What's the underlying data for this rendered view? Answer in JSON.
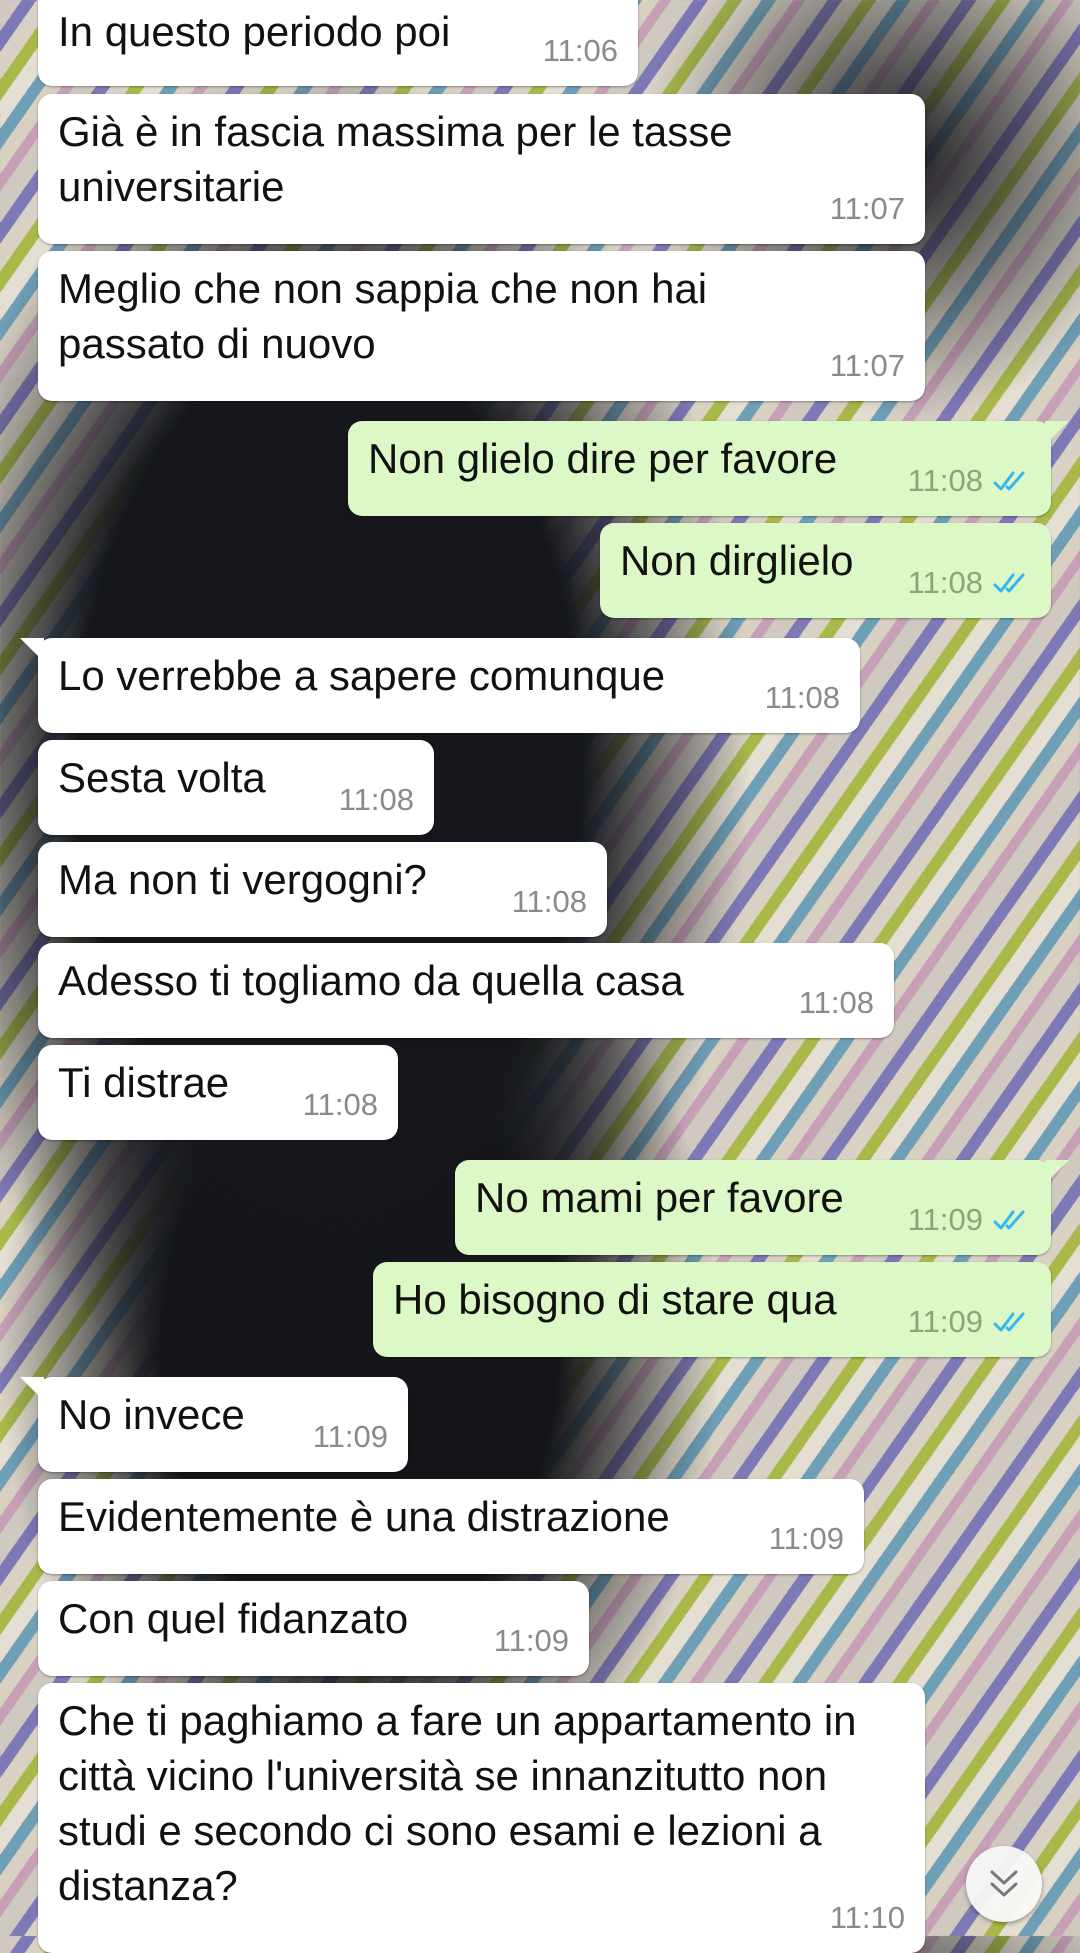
{
  "messages": [
    {
      "dir": "in",
      "text": "In questo periodo poi",
      "time": "11:06"
    },
    {
      "dir": "in",
      "text": "Già è in fascia massima per le tasse universitarie",
      "time": "11:07"
    },
    {
      "dir": "in",
      "text": "Meglio che non sappia che non hai passato di nuovo",
      "time": "11:07"
    },
    {
      "dir": "out",
      "text": "Non glielo dire per favore",
      "time": "11:08",
      "status": "read"
    },
    {
      "dir": "out",
      "text": "Non dirglielo",
      "time": "11:08",
      "status": "read"
    },
    {
      "dir": "in",
      "text": "Lo verrebbe a sapere comunque",
      "time": "11:08"
    },
    {
      "dir": "in",
      "text": "Sesta volta",
      "time": "11:08"
    },
    {
      "dir": "in",
      "text": "Ma non ti vergogni?",
      "time": "11:08"
    },
    {
      "dir": "in",
      "text": "Adesso ti togliamo da quella casa",
      "time": "11:08"
    },
    {
      "dir": "in",
      "text": "Ti distrae",
      "time": "11:08"
    },
    {
      "dir": "out",
      "text": "No mami per favore",
      "time": "11:09",
      "status": "read"
    },
    {
      "dir": "out",
      "text": "Ho bisogno di stare qua",
      "time": "11:09",
      "status": "read"
    },
    {
      "dir": "in",
      "text": "No invece",
      "time": "11:09"
    },
    {
      "dir": "in",
      "text": "Evidentemente è una distrazione",
      "time": "11:09"
    },
    {
      "dir": "in",
      "text": "Con quel fidanzato",
      "time": "11:09"
    },
    {
      "dir": "in",
      "text": "Che ti paghiamo a fare un appartamento in città vicino l'università se innanzitutto non studi e secondo ci sono esami e lezioni a distanza?",
      "time": "11:10"
    }
  ],
  "scroll_button": {
    "icon": "double-chevron-down-icon"
  },
  "colors": {
    "incoming_bubble": "#ffffff",
    "outgoing_bubble": "#dcf8c6",
    "read_ticks": "#34b7f1"
  }
}
